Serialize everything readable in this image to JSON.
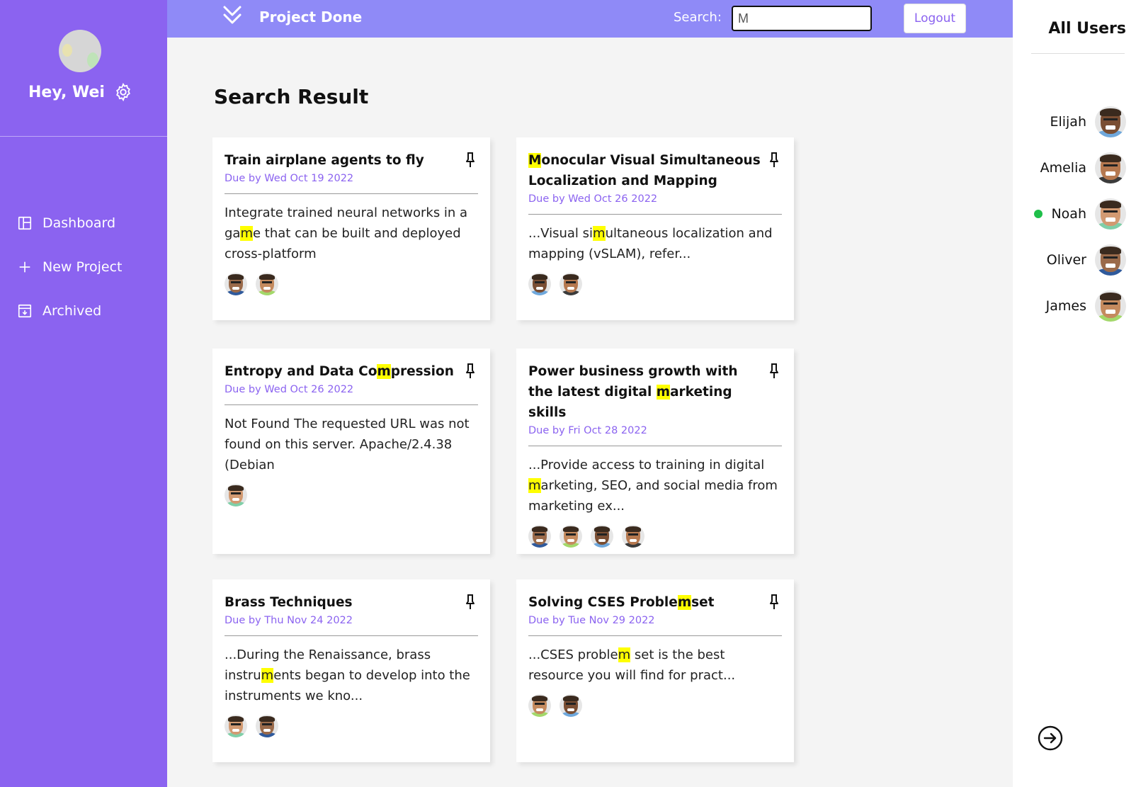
{
  "sidebar": {
    "greeting": "Hey, Wei",
    "nav": [
      {
        "label": "Dashboard",
        "icon": "dashboard-icon"
      },
      {
        "label": "New Project",
        "icon": "plus-icon"
      },
      {
        "label": "Archived",
        "icon": "archive-icon"
      }
    ]
  },
  "topbar": {
    "brand": "Project Done",
    "search_label": "Search:",
    "search_value": "M",
    "logout_label": "Logout"
  },
  "main": {
    "title": "Search Result",
    "cards": [
      {
        "title_parts": [
          "Train airplane agents to fly"
        ],
        "due": "Due by Wed Oct 19 2022",
        "desc_parts": [
          "Integrate trained neural networks in a ga",
          "m",
          "e that can be built and deployed cross-platform"
        ]
      },
      {
        "title_parts": [
          "",
          "M",
          "onocular Visual Simultaneous Localization and Mapping"
        ],
        "due": "Due by Wed Oct 26 2022",
        "desc_parts": [
          "...Visual si",
          "m",
          "ultaneous localization and mapping (vSLAM), refer..."
        ]
      },
      {
        "title_parts": [
          "Entropy and Data Co",
          "m",
          "pression"
        ],
        "due": "Due by Wed Oct 26 2022",
        "desc_parts": [
          "Not Found The requested URL was not found on this server. Apache/2.4.38 (Debian"
        ]
      },
      {
        "title_parts": [
          "Power business growth with the latest digital ",
          "m",
          "arketing skills"
        ],
        "due": "Due by Fri Oct 28 2022",
        "desc_parts": [
          "...Provide access to training in digital ",
          "m",
          "arketing, SEO, and social media from marketing ex..."
        ]
      },
      {
        "title_parts": [
          "Brass Techniques"
        ],
        "due": "Due by Thu Nov 24 2022",
        "desc_parts": [
          "...During the Renaissance, brass instru",
          "m",
          "ents began to develop into the instruments we kno..."
        ]
      },
      {
        "title_parts": [
          "Solving CSES Proble",
          "m",
          "set"
        ],
        "due": "Due by Tue Nov 29 2022",
        "desc_parts": [
          "...CSES proble",
          "m",
          " set is the best resource you will find for pract..."
        ]
      }
    ]
  },
  "users": {
    "title": "All Users",
    "list": [
      {
        "name": "Elijah",
        "online": false
      },
      {
        "name": "Amelia",
        "online": false
      },
      {
        "name": "Noah",
        "online": true
      },
      {
        "name": "Oliver",
        "online": false
      },
      {
        "name": "James",
        "online": false
      }
    ]
  },
  "colors": {
    "sidebar": "#8b63f0",
    "topbar": "#8f8af7",
    "accent": "#8b63f0",
    "highlight": "#ffff00",
    "online": "#1fbf4a"
  }
}
